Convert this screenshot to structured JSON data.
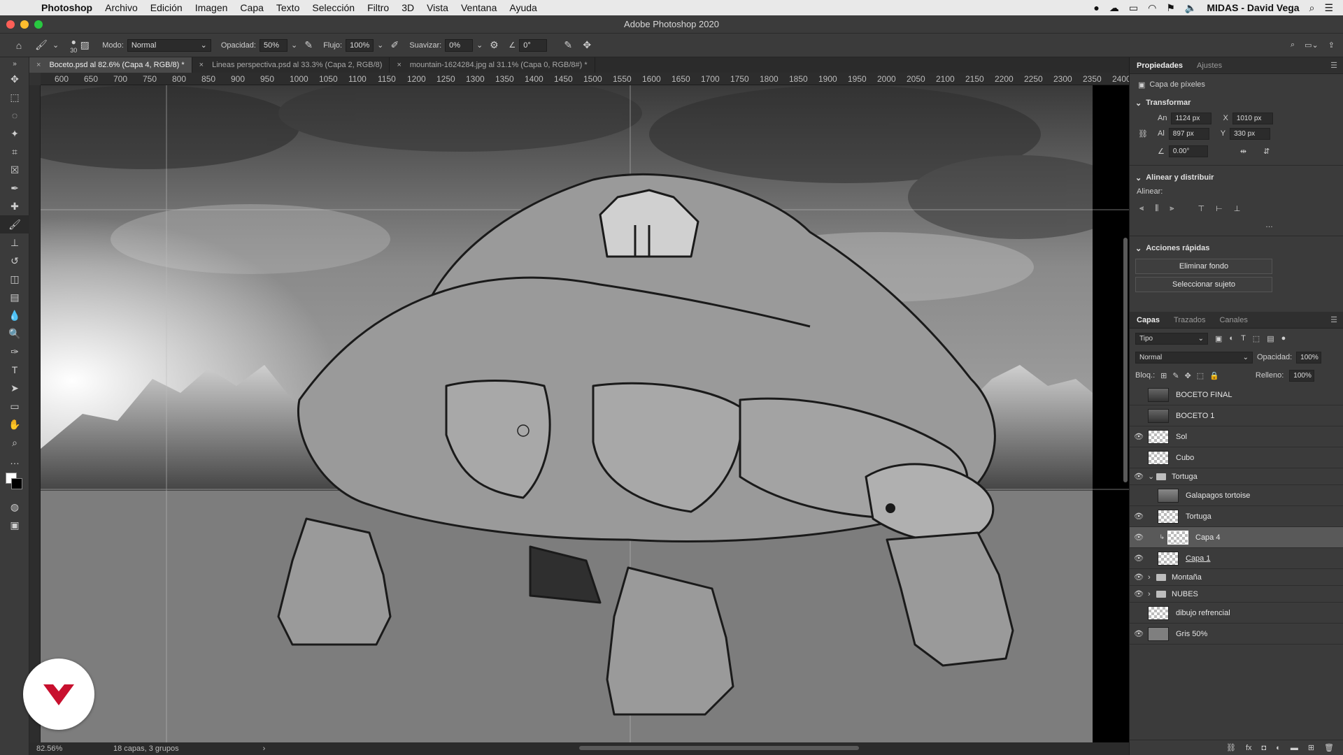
{
  "menubar": {
    "app": "Photoshop",
    "items": [
      "Archivo",
      "Edición",
      "Imagen",
      "Capa",
      "Texto",
      "Selección",
      "Filtro",
      "3D",
      "Vista",
      "Ventana",
      "Ayuda"
    ],
    "user": "MIDAS - David Vega"
  },
  "window": {
    "title": "Adobe Photoshop 2020"
  },
  "options": {
    "brush_size": "30",
    "mode_label": "Modo:",
    "mode_value": "Normal",
    "opacity_label": "Opacidad:",
    "opacity_value": "50%",
    "flow_label": "Flujo:",
    "flow_value": "100%",
    "smooth_label": "Suavizar:",
    "smooth_value": "0%",
    "angle_value": "0°"
  },
  "tabs": [
    {
      "label": "Boceto.psd al 82.6% (Capa 4, RGB/8) *",
      "active": true
    },
    {
      "label": "Lineas perspectiva.psd al 33.3% (Capa 2, RGB/8)",
      "active": false
    },
    {
      "label": "mountain-1624284.jpg al 31.1% (Capa 0, RGB/8#) *",
      "active": false
    }
  ],
  "ruler": {
    "ticks": [
      "600",
      "650",
      "700",
      "750",
      "800",
      "850",
      "900",
      "950",
      "1000",
      "1050",
      "1100",
      "1150",
      "1200",
      "1250",
      "1300",
      "1350",
      "1400",
      "1450",
      "1500",
      "1550",
      "1600",
      "1650",
      "1700",
      "1750",
      "1800",
      "1850",
      "1900",
      "1950",
      "2000",
      "2050",
      "2100",
      "2150",
      "2200",
      "2250",
      "2300",
      "2350",
      "2400"
    ]
  },
  "status": {
    "zoom": "82.56%",
    "info": "18 capas, 3 grupos"
  },
  "properties": {
    "tab_props": "Propiedades",
    "tab_adjust": "Ajustes",
    "layer_kind": "Capa de píxeles",
    "transform_title": "Transformar",
    "w_label": "An",
    "w_value": "1124 px",
    "x_label": "X",
    "x_value": "1010 px",
    "h_label": "Al",
    "h_value": "897 px",
    "y_label": "Y",
    "y_value": "330 px",
    "angle_value": "0.00°",
    "align_title": "Alinear y distribuir",
    "align_label": "Alinear:",
    "quick_title": "Acciones rápidas",
    "btn_remove_bg": "Eliminar fondo",
    "btn_select_subject": "Seleccionar sujeto"
  },
  "layers_panel": {
    "tab_layers": "Capas",
    "tab_paths": "Trazados",
    "tab_channels": "Canales",
    "filter_label": "Tipo",
    "blend_mode": "Normal",
    "opacity_label": "Opacidad:",
    "opacity_value": "100%",
    "lock_label": "Bloq.:",
    "fill_label": "Relleno:",
    "fill_value": "100%",
    "layers": [
      {
        "name": "BOCETO FINAL",
        "visible": false
      },
      {
        "name": "BOCETO 1",
        "visible": false
      },
      {
        "name": "Sol",
        "visible": true
      },
      {
        "name": "Cubo",
        "visible": false
      },
      {
        "name": "Tortuga",
        "visible": true,
        "group": true
      },
      {
        "name": "Galapagos tortoise",
        "visible": false
      },
      {
        "name": "Tortuga",
        "visible": true
      },
      {
        "name": "Capa 4",
        "visible": true,
        "selected": true
      },
      {
        "name": "Capa 1",
        "visible": true
      },
      {
        "name": "Montaña",
        "visible": true,
        "group": true
      },
      {
        "name": "NUBES",
        "visible": true,
        "group": true
      },
      {
        "name": "dibujo refrencial",
        "visible": false
      },
      {
        "name": "Gris 50%",
        "visible": true
      }
    ]
  },
  "colors": {
    "accent": "#c8102e",
    "panel_bg": "#3b3b3b",
    "canvas_bg": "#535353"
  }
}
